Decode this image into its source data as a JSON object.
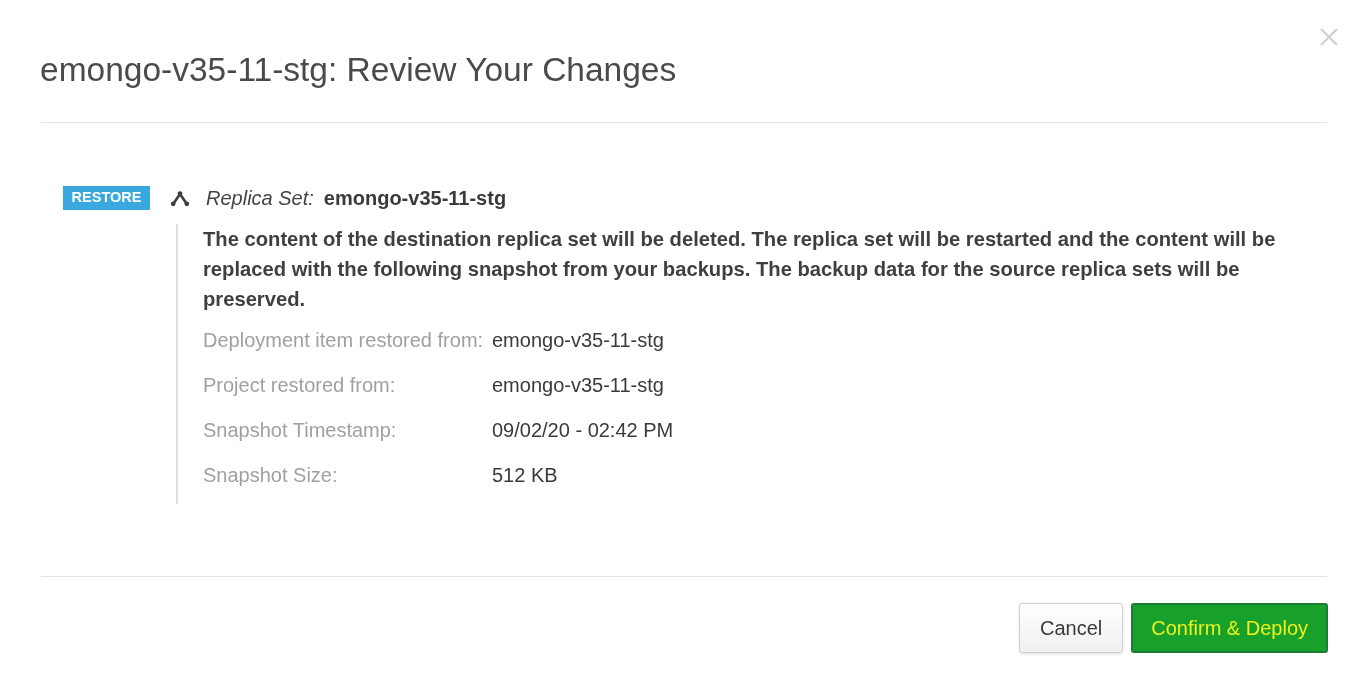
{
  "dialog": {
    "title": "emongo-v35-11-stg: Review Your Changes"
  },
  "change": {
    "badge": "RESTORE",
    "type_label": "Replica Set:",
    "name": "emongo-v35-11-stg",
    "description": "The content of the destination replica set will be deleted. The replica set will be restarted and the content will be replaced with the following snapshot from your backups. The backup data for the source replica sets will be preserved.",
    "details": [
      {
        "label": "Deployment item restored from:",
        "value": "emongo-v35-11-stg"
      },
      {
        "label": "Project restored from:",
        "value": "emongo-v35-11-stg"
      },
      {
        "label": "Snapshot Timestamp:",
        "value": "09/02/20 - 02:42 PM"
      },
      {
        "label": "Snapshot Size:",
        "value": "512 KB"
      }
    ]
  },
  "buttons": [
    {
      "label": "Cancel",
      "kind": "secondary"
    },
    {
      "label": "Confirm & Deploy",
      "kind": "primary"
    }
  ]
}
